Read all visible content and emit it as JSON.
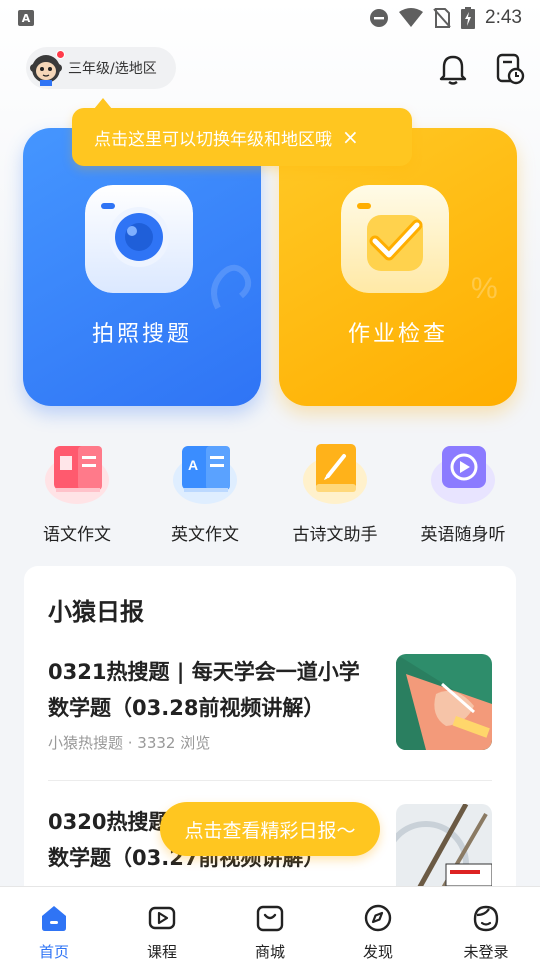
{
  "status_bar": {
    "time": "2:43"
  },
  "header": {
    "grade_label": "三年级/选地区"
  },
  "tooltip": {
    "text": "点击这里可以切换年级和地区哦",
    "close": "×"
  },
  "cards": [
    {
      "label": "拍照搜题",
      "color": "#2f74f5"
    },
    {
      "label": "作业检查",
      "color": "#ffae00"
    }
  ],
  "tools": [
    {
      "label": "语文作文",
      "icon": "book-icon"
    },
    {
      "label": "英文作文",
      "icon": "dictionary-icon"
    },
    {
      "label": "古诗文助手",
      "icon": "brush-book-icon"
    },
    {
      "label": "英语随身听",
      "icon": "play-icon"
    }
  ],
  "news": {
    "title": "小猿日报",
    "articles": [
      {
        "title": "0321热搜题 | 每天学会一道小学数学题（03.28前视频讲解）",
        "meta": "小猿热搜题 · 3332 浏览"
      },
      {
        "title": "0320热搜题 | 每天学会一道小学数学题（03.27前视频讲解）"
      }
    ]
  },
  "floating_button": {
    "label": "点击查看精彩日报～"
  },
  "bottom_nav": [
    {
      "label": "首页",
      "active": true
    },
    {
      "label": "课程"
    },
    {
      "label": "商城"
    },
    {
      "label": "发现"
    },
    {
      "label": "未登录"
    }
  ],
  "colors": {
    "accent_blue": "#2f74f5",
    "accent_yellow": "#ffc620"
  }
}
